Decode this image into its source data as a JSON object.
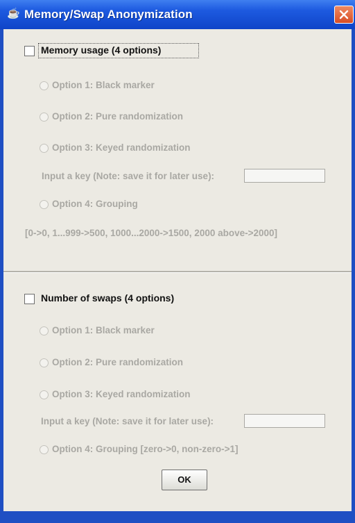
{
  "window": {
    "title": "Memory/Swap Anonymization",
    "icon": "java-cup-icon"
  },
  "memory_section": {
    "label": "Memory usage (4 options)",
    "checked": false,
    "options": [
      {
        "label": "Option 1: Black marker",
        "selected": false
      },
      {
        "label": "Option 2: Pure randomization",
        "selected": false
      },
      {
        "label": "Option 3: Keyed randomization",
        "selected": false
      },
      {
        "label": "Option 4: Grouping",
        "selected": false
      }
    ],
    "key_prompt": "Input a key (Note: save it for later use):",
    "key_value": "",
    "grouping_rule": "[0->0, 1...999->500, 1000...2000->1500, 2000 above->2000]"
  },
  "swaps_section": {
    "label": "Number of swaps (4 options)",
    "checked": false,
    "options": [
      {
        "label": "Option 1: Black marker",
        "selected": false
      },
      {
        "label": "Option 2: Pure randomization",
        "selected": false
      },
      {
        "label": "Option 3: Keyed randomization",
        "selected": false
      },
      {
        "label": "Option 4: Grouping [zero->0, non-zero->1]",
        "selected": false
      }
    ],
    "key_prompt": "Input a key (Note: save it for later use):",
    "key_value": ""
  },
  "buttons": {
    "ok_label": "OK"
  },
  "colors": {
    "title_bar": "#1d5ae0",
    "panel": "#eceae3",
    "disabled_text": "#a9a8a3",
    "close_button": "#d84d25"
  }
}
